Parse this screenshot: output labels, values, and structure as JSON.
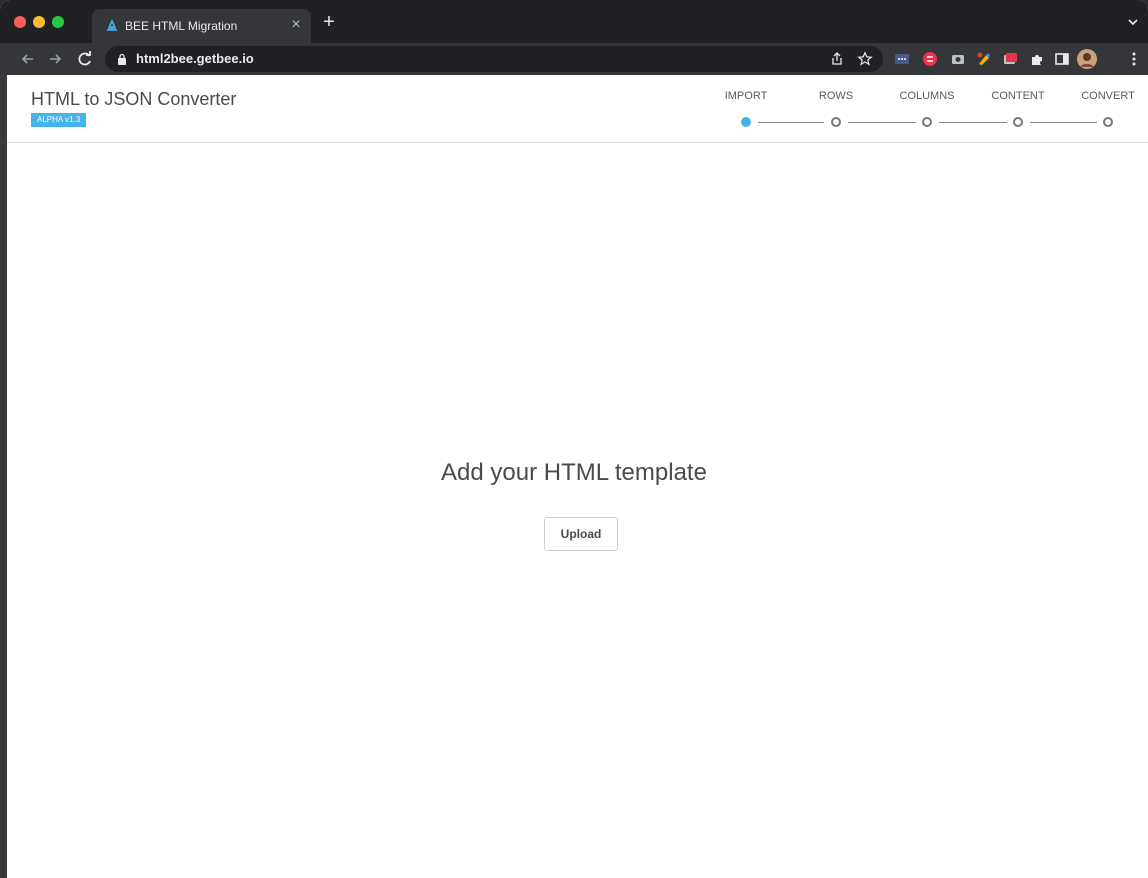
{
  "browser": {
    "tab": {
      "title": "BEE HTML Migration",
      "close_glyph": "×"
    },
    "new_tab_glyph": "+",
    "address_bar": {
      "url": "html2bee.getbee.io"
    },
    "icons": {
      "back": "back-arrow-icon",
      "forward": "forward-arrow-icon",
      "reload": "reload-icon",
      "lock": "lock-icon",
      "share": "share-icon",
      "bookmark": "star-icon"
    },
    "extensions": [
      "more-dots-extension-icon",
      "red-extension-icon",
      "camera-extension-icon",
      "color-picker-extension-icon",
      "red-card-extension-icon",
      "puzzle-icon",
      "sidebar-icon",
      "profile-avatar",
      "kebab-menu-icon"
    ],
    "colors": {
      "close": "#ff5f57",
      "minimize": "#febc2e",
      "maximize": "#28c840"
    }
  },
  "app": {
    "title": "HTML to JSON Converter",
    "badge": "ALPHA v1.3",
    "accent_color": "#46b3e6",
    "steps": [
      {
        "label": "IMPORT",
        "active": true
      },
      {
        "label": "ROWS",
        "active": false
      },
      {
        "label": "COLUMNS",
        "active": false
      },
      {
        "label": "CONTENT",
        "active": false
      },
      {
        "label": "CONVERT",
        "active": false
      }
    ]
  },
  "main": {
    "heading": "Add your HTML template",
    "upload_label": "Upload"
  }
}
